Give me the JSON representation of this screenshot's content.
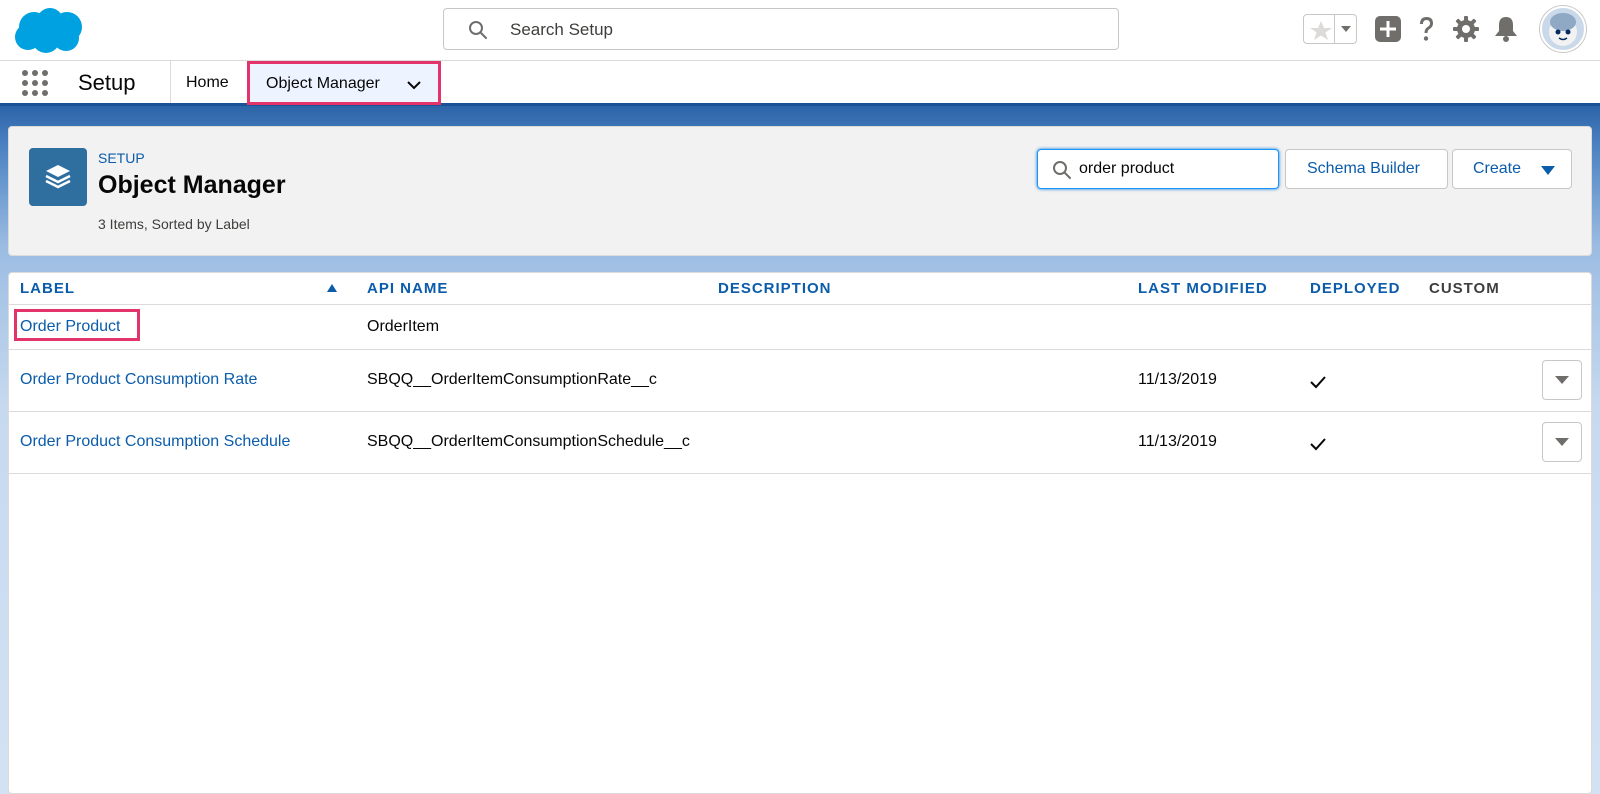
{
  "header": {
    "logo": "salesforce-cloud-logo",
    "search_placeholder": "Search Setup",
    "icons": [
      "star-icon",
      "chevron-down-icon",
      "add-icon",
      "help-icon",
      "gear-icon",
      "bell-icon",
      "avatar"
    ]
  },
  "context_bar": {
    "app_name": "Setup",
    "nav": [
      {
        "label": "Home"
      },
      {
        "label": "Object Manager",
        "active": true
      }
    ]
  },
  "page_header": {
    "eyebrow": "SETUP",
    "title": "Object Manager",
    "meta": "3 Items, Sorted by Label",
    "quick_find_value": "order product",
    "buttons": {
      "schema_builder": "Schema Builder",
      "create": "Create"
    }
  },
  "table": {
    "columns": [
      "LABEL",
      "API NAME",
      "DESCRIPTION",
      "LAST MODIFIED",
      "DEPLOYED",
      "CUSTOM"
    ],
    "sorted_by": "LABEL",
    "sort_direction": "ascending",
    "rows": [
      {
        "label": "Order Product",
        "api_name": "OrderItem",
        "description": "",
        "last_modified": "",
        "deployed": false,
        "custom": false,
        "has_menu": false,
        "highlighted": true
      },
      {
        "label": "Order Product Consumption Rate",
        "api_name": "SBQQ__OrderItemConsumptionRate__c",
        "description": "",
        "last_modified": "11/13/2019",
        "deployed": true,
        "custom": false,
        "has_menu": true,
        "highlighted": false
      },
      {
        "label": "Order Product Consumption Schedule",
        "api_name": "SBQQ__OrderItemConsumptionSchedule__c",
        "description": "",
        "last_modified": "11/13/2019",
        "deployed": true,
        "custom": false,
        "has_menu": true,
        "highlighted": false
      }
    ]
  },
  "colors": {
    "brand_blue": "#0b5cab",
    "highlight": "#e2336b",
    "object_icon": "#2e6fa0",
    "nav_border": "#1b5297"
  }
}
